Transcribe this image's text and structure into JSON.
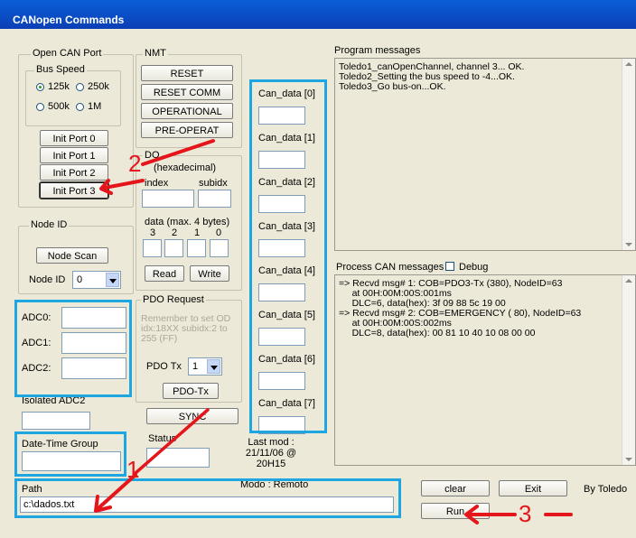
{
  "window": {
    "title": "CANopen Commands"
  },
  "open_can_port": {
    "group_label": "Open CAN Port",
    "bus_speed_label": "Bus Speed",
    "speeds": [
      {
        "label": "125k",
        "selected": true
      },
      {
        "label": "250k",
        "selected": false
      },
      {
        "label": "500k",
        "selected": false
      },
      {
        "label": "1M",
        "selected": false
      }
    ],
    "init_buttons": [
      "Init Port 0",
      "Init Port 1",
      "Init Port 2",
      "Init Port 3"
    ]
  },
  "nmt": {
    "group_label": "NMT",
    "buttons": [
      "RESET",
      "RESET COMM",
      "OPERATIONAL",
      "PRE-OPERAT"
    ]
  },
  "sdo": {
    "group_label": "DO",
    "subtitle": "(hexadecimal)",
    "index_label": "index",
    "subidx_label": "subidx",
    "data_label": "data (max. 4 bytes)",
    "byte_labels": [
      "3",
      "2",
      "1",
      "0"
    ],
    "read_label": "Read",
    "write_label": "Write"
  },
  "node_id": {
    "group_label": "Node ID",
    "scan_label": "Node Scan",
    "id_label": "Node ID",
    "id_value": "0"
  },
  "adc": {
    "labels": [
      "ADC0:",
      "ADC1:",
      "ADC2:"
    ],
    "isolated_label": "Isolated ADC2"
  },
  "pdo": {
    "group_label": "PDO Request",
    "note": "Remember to set OD idx:18XX subidx:2 to 255 (FF)",
    "tx_label": "PDO Tx",
    "tx_value": "1",
    "tx_button": "PDO-Tx"
  },
  "sync_label": "SYNC",
  "status_label": "Status",
  "datetime_label": "Date-Time Group",
  "last_mod": {
    "line1": "Last mod :",
    "line2": "21/11/06 @",
    "line3": "20H15"
  },
  "mode_text": "Modo : Remoto",
  "can_data": [
    "Can_data [0]",
    "Can_data [1]",
    "Can_data [2]",
    "Can_data [3]",
    "Can_data [4]",
    "Can_data [5]",
    "Can_data [6]",
    "Can_data [7]"
  ],
  "program_messages": {
    "label": "Program messages",
    "lines": [
      "Toledo1_canOpenChannel, channel 3... OK.",
      "Toledo2_Setting the bus speed to -4...OK.",
      "Toledo3_Go bus-on...OK."
    ]
  },
  "process_messages": {
    "label": "Process CAN messages",
    "debug_label": "Debug",
    "lines": [
      "=> Recvd msg# 1: COB=PDO3-Tx (380), NodeID=63",
      "     at 00H:00M:00S:001ms",
      "     DLC=6, data(hex): 3f 09 88 5c 19 00",
      "",
      "=> Recvd msg# 2: COB=EMERGENCY ( 80), NodeID=63",
      "     at 00H:00M:00S:002ms",
      "     DLC=8, data(hex): 00 81 10 40 10 08 00 00"
    ]
  },
  "path": {
    "label": "Path",
    "value": "c:\\dados.txt"
  },
  "buttons": {
    "clear": "clear",
    "exit": "Exit",
    "run": "Run"
  },
  "credit": "By Toledo",
  "annotations": {
    "one": "1",
    "two": "2",
    "three": "3",
    "accent_color": "#e4161b",
    "highlight_color": "#1ea6e0"
  }
}
